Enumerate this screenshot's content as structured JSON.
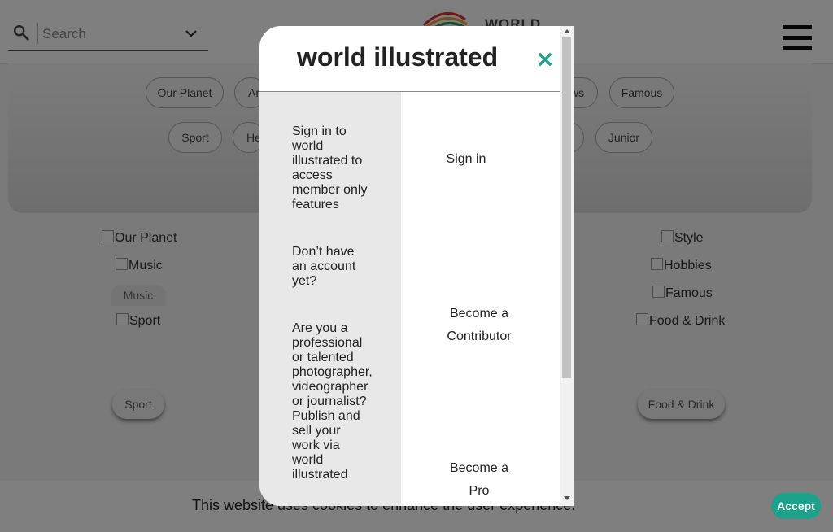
{
  "header": {
    "search_placeholder": "Search",
    "logo_text": "WORLD",
    "icons": {
      "search": "search-icon",
      "dropdown": "chevron-down-icon",
      "menu": "hamburger-menu-icon",
      "logo": "globe-logo-icon"
    }
  },
  "categories": {
    "row1": [
      "Our Planet",
      "Ar",
      "ws",
      "Famous"
    ],
    "row2": [
      "Sport",
      "He",
      "",
      "Junior"
    ]
  },
  "tiles": {
    "left": [
      "Our Planet",
      "Music",
      "Sport"
    ],
    "left_labels": [
      "Music",
      "Sport"
    ],
    "right": [
      "Style",
      "Hobbies",
      "Famous",
      "Food & Drink"
    ],
    "right_labels": [
      "Food & Drink"
    ]
  },
  "cookie": {
    "text": "This website uses cookies to enhance the user experience.",
    "accept_label": "Accept"
  },
  "modal": {
    "title": "world illustrated",
    "close_icon": "close-icon",
    "sections": [
      {
        "text": [
          "Sign in to",
          "world",
          "illustrated to",
          "access",
          "member only",
          "features"
        ],
        "link": [
          "Sign in"
        ]
      },
      {
        "text": [
          "Don’t have",
          "an account",
          "yet?"
        ],
        "link": [
          "Become a",
          "Contributor"
        ]
      },
      {
        "text": [
          "Are you a",
          "professional",
          "or talented",
          "photographer,",
          "videographer",
          "or journalist?",
          "Publish and",
          "sell your",
          "work via",
          "world",
          "illustrated"
        ],
        "link": [
          "Become a",
          "Pro"
        ]
      }
    ]
  },
  "colors": {
    "accent": "#1aa38a",
    "overlay": "rgba(0,0,0,0.5)",
    "left_column": "#e8e8e8"
  }
}
